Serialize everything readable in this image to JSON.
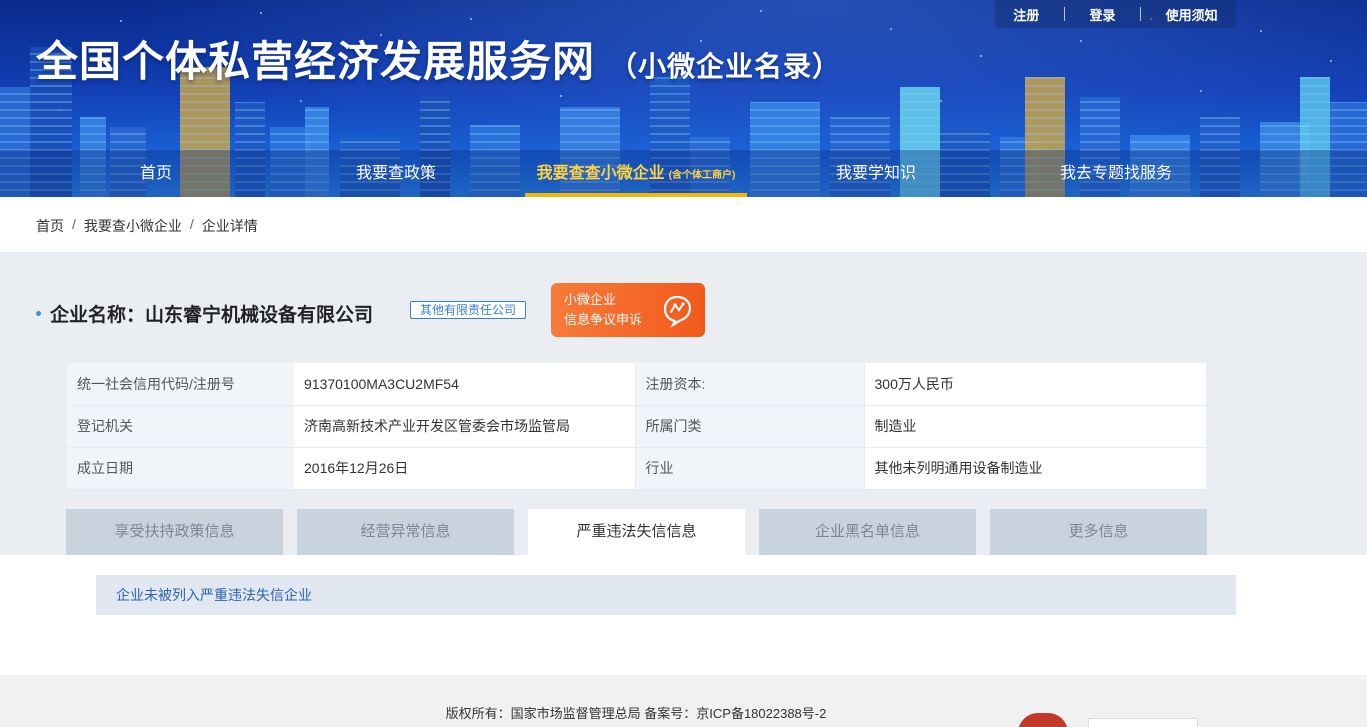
{
  "header": {
    "title": "全国个体私营经济发展服务网",
    "subtitle": "（小微企业名录）",
    "user_links": [
      "注册",
      "登录",
      "使用须知"
    ]
  },
  "nav": {
    "items": [
      {
        "label": "首页"
      },
      {
        "label": "我要查政策"
      },
      {
        "label": "我要查查小微企业",
        "small": "(含个体工商户)"
      },
      {
        "label": "我要学知识"
      },
      {
        "label": "我去专题找服务"
      }
    ],
    "active": "我要查查小微企业",
    "active_color": "#ffd23f"
  },
  "breadcrumb": [
    "首页",
    "我要查小微企业",
    "企业详情"
  ],
  "company": {
    "label": "企业名称：",
    "name": "山东睿宁机械设备有限公司",
    "type_tag": "其他有限责任公司",
    "appeal_line1": "小微企业",
    "appeal_line2": "信息争议申诉",
    "appeal_icon": "chat-support-icon"
  },
  "info": [
    [
      "统一社会信用代码/注册号",
      "91370100MA3CU2MF54",
      "注册资本:",
      "300万人民币"
    ],
    [
      "登记机关",
      "济南高新技术产业开发区管委会市场监管局",
      "所属门类",
      "制造业"
    ],
    [
      "成立日期",
      "2016年12月26日",
      "行业",
      "其他未列明通用设备制造业"
    ]
  ],
  "tabs": [
    "享受扶持政策信息",
    "经营异常信息",
    "严重违法失信信息",
    "企业黑名单信息",
    "更多信息"
  ],
  "active_tab": "严重违法失信信息",
  "result_text": "企业未被列入严重违法失信企业",
  "footer": {
    "copyright": "版权所有：国家市场监督管理总局 备案号：京ICP备18022388号-2"
  }
}
